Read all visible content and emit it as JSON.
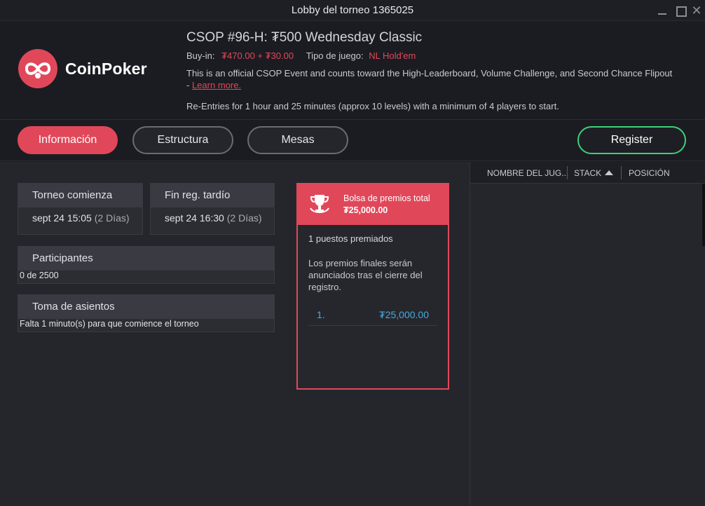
{
  "window": {
    "title": "Lobby del torneo 1365025",
    "close_glyph": "✕"
  },
  "brand": {
    "name": "CoinPoker",
    "accent": "#e0485a"
  },
  "tournament": {
    "name": "CSOP #96-H: ₮500 Wednesday Classic",
    "buyin_label": "Buy-in:",
    "buyin_value": "₮470.00 + ₮30.00",
    "game_label": "Tipo de juego:",
    "game_value": "NL Hold'em",
    "description": "This is an official CSOP Event and counts toward the High-Leaderboard, Volume Challenge, and Second Chance Flipout - ",
    "learn_more": "Learn more.",
    "reentry": "Re-Entries for 1 hour and 25 minutes (approx 10 levels) with a minimum of 4 players to start."
  },
  "tabs": [
    {
      "label": "Información",
      "active": true
    },
    {
      "label": "Estructura",
      "active": false
    },
    {
      "label": "Mesas",
      "active": false
    }
  ],
  "register_label": "Register",
  "cards": {
    "start": {
      "title": "Torneo comienza",
      "date": "sept 24 15:05",
      "rel": "(2 Días)"
    },
    "late_reg": {
      "title": "Fin reg. tardío",
      "date": "sept 24 16:30",
      "rel": "(2 Días)"
    },
    "entrants": {
      "title": "Participantes",
      "value": "0 de 2500"
    },
    "seating": {
      "title": "Toma de asientos",
      "value": "Falta 1 minuto(s) para que comience el torneo"
    }
  },
  "prize_pool": {
    "title": "Bolsa de premios total",
    "amount": "₮25,000.00",
    "places": "1 puestos premiados",
    "note": "Los premios finales serán anunciados tras el cierre del registro.",
    "rows": [
      {
        "position": "1.",
        "amount": "₮25,000.00"
      }
    ],
    "icon": "trophy-icon"
  },
  "players_table": {
    "columns": [
      "NOMBRE DEL JUG...",
      "STACK",
      "POSICIÓN"
    ],
    "sort_column": "STACK",
    "sort_direction": "asc"
  }
}
